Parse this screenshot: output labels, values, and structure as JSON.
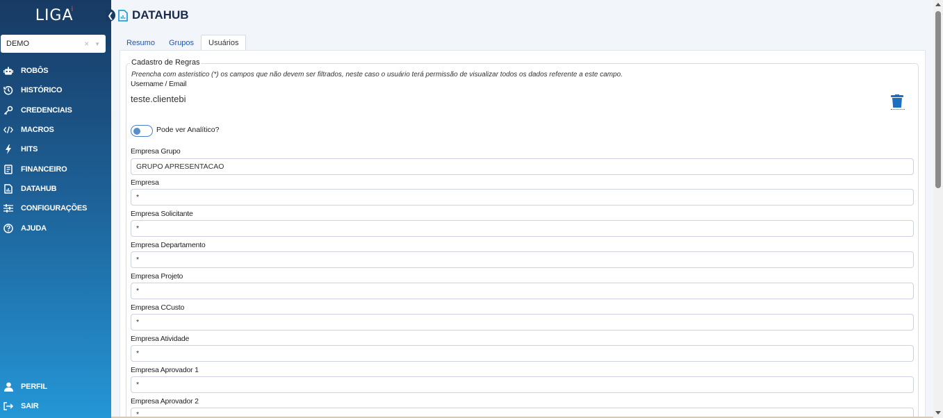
{
  "app": {
    "logo": "LIGA",
    "logo_mark": "i"
  },
  "sidebar": {
    "collapse_icon": "chevron-left-icon",
    "tenant": {
      "value": "DEMO",
      "clear": "×",
      "caret": "▼"
    },
    "items": [
      {
        "label": "ROBÔS",
        "icon": "robot-icon"
      },
      {
        "label": "HISTÓRICO",
        "icon": "history-icon"
      },
      {
        "label": "CREDENCIAIS",
        "icon": "key-icon"
      },
      {
        "label": "MACROS",
        "icon": "code-icon"
      },
      {
        "label": "HITS",
        "icon": "bolt-icon"
      },
      {
        "label": "FINANCEIRO",
        "icon": "invoice-icon"
      },
      {
        "label": "DATAHUB",
        "icon": "file-chart-icon"
      },
      {
        "label": "CONFIGURAÇÕES",
        "icon": "sliders-icon"
      },
      {
        "label": "AJUDA",
        "icon": "help-icon"
      }
    ],
    "bottom": [
      {
        "label": "PERFIL",
        "icon": "user-icon"
      },
      {
        "label": "SAIR",
        "icon": "logout-icon"
      }
    ]
  },
  "header": {
    "title": "DATAHUB"
  },
  "tabs": [
    {
      "label": "Resumo",
      "active": false
    },
    {
      "label": "Grupos",
      "active": false
    },
    {
      "label": "Usuários",
      "active": true
    }
  ],
  "form": {
    "legend": "Cadastro de Regras",
    "hint": "Preencha com asteristico (*) os campos que não devem ser filtrados, neste caso o usuário terá permissão de visualizar todos os dados referente a este campo.",
    "username_label": "Username / Email",
    "username_value": "teste.clientebi",
    "toggle_label": "Pode ver Analítico?",
    "toggle_on": false,
    "fields": [
      {
        "label": "Empresa Grupo",
        "value": "GRUPO APRESENTACAO"
      },
      {
        "label": "Empresa",
        "value": "*"
      },
      {
        "label": "Empresa Solicitante",
        "value": "*"
      },
      {
        "label": "Empresa Departamento",
        "value": "*"
      },
      {
        "label": "Empresa Projeto",
        "value": "*"
      },
      {
        "label": "Empresa CCusto",
        "value": "*"
      },
      {
        "label": "Empresa Atividade",
        "value": "*"
      },
      {
        "label": "Empresa Aprovador 1",
        "value": "*"
      },
      {
        "label": "Empresa Aprovador 2",
        "value": "*"
      }
    ]
  },
  "colors": {
    "sidebar_top": "#173a63",
    "sidebar_bottom": "#2596d6",
    "accent": "#1d6fc0",
    "page_bg": "#f2f6fb"
  }
}
